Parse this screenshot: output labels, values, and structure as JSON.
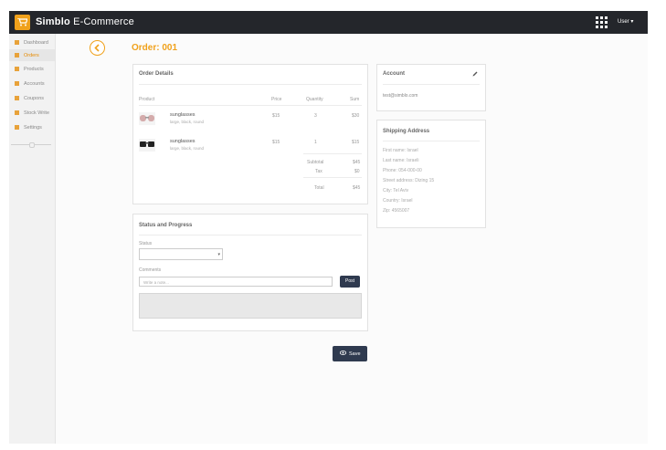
{
  "header": {
    "brand_simblo": "Simblo",
    "brand_rest": "E-Commerce",
    "user_label": "User ▾"
  },
  "sidebar": {
    "items": [
      {
        "label": "Dashboard"
      },
      {
        "label": "Orders"
      },
      {
        "label": "Products"
      },
      {
        "label": "Accounts"
      },
      {
        "label": "Coupons"
      },
      {
        "label": "Stock Write"
      },
      {
        "label": "Settings"
      }
    ],
    "active_index": 1
  },
  "page": {
    "title": "Order: 001"
  },
  "order_details": {
    "title": "Order Details",
    "columns": {
      "product": "Product",
      "price": "Price",
      "quantity": "Quantity",
      "sum": "Sum"
    },
    "rows": [
      {
        "name": "sunglasses",
        "sub": "large, black, round",
        "price": "$15",
        "quantity": "3",
        "sum": "$30"
      },
      {
        "name": "sunglasses",
        "sub": "large, black, round",
        "price": "$15",
        "quantity": "1",
        "sum": "$15"
      }
    ],
    "subtotal_label": "Subtotal",
    "subtotal_value": "$45",
    "tax_label": "Tax",
    "tax_value": "$0",
    "total_label": "Total",
    "total_value": "$45"
  },
  "status": {
    "title": "Status and Progress",
    "status_label": "Status",
    "status_value": "",
    "comments_label": "Comments",
    "comment_placeholder": "Write a note...",
    "post_label": "Post"
  },
  "account": {
    "title": "Account",
    "email": "test@simblo.com"
  },
  "shipping": {
    "title": "Shipping Address",
    "lines": [
      "First name: Israel",
      "Last name: Israeli",
      "Phone: 054-000-00",
      "Street address: Dizing 15",
      "City: Tel Aviv",
      "Country: Israel",
      "Zip: 4565007"
    ]
  },
  "save_label": "Save",
  "colors": {
    "accent": "#f0a11b",
    "topbar": "#24262b",
    "button": "#2f3a4f"
  }
}
